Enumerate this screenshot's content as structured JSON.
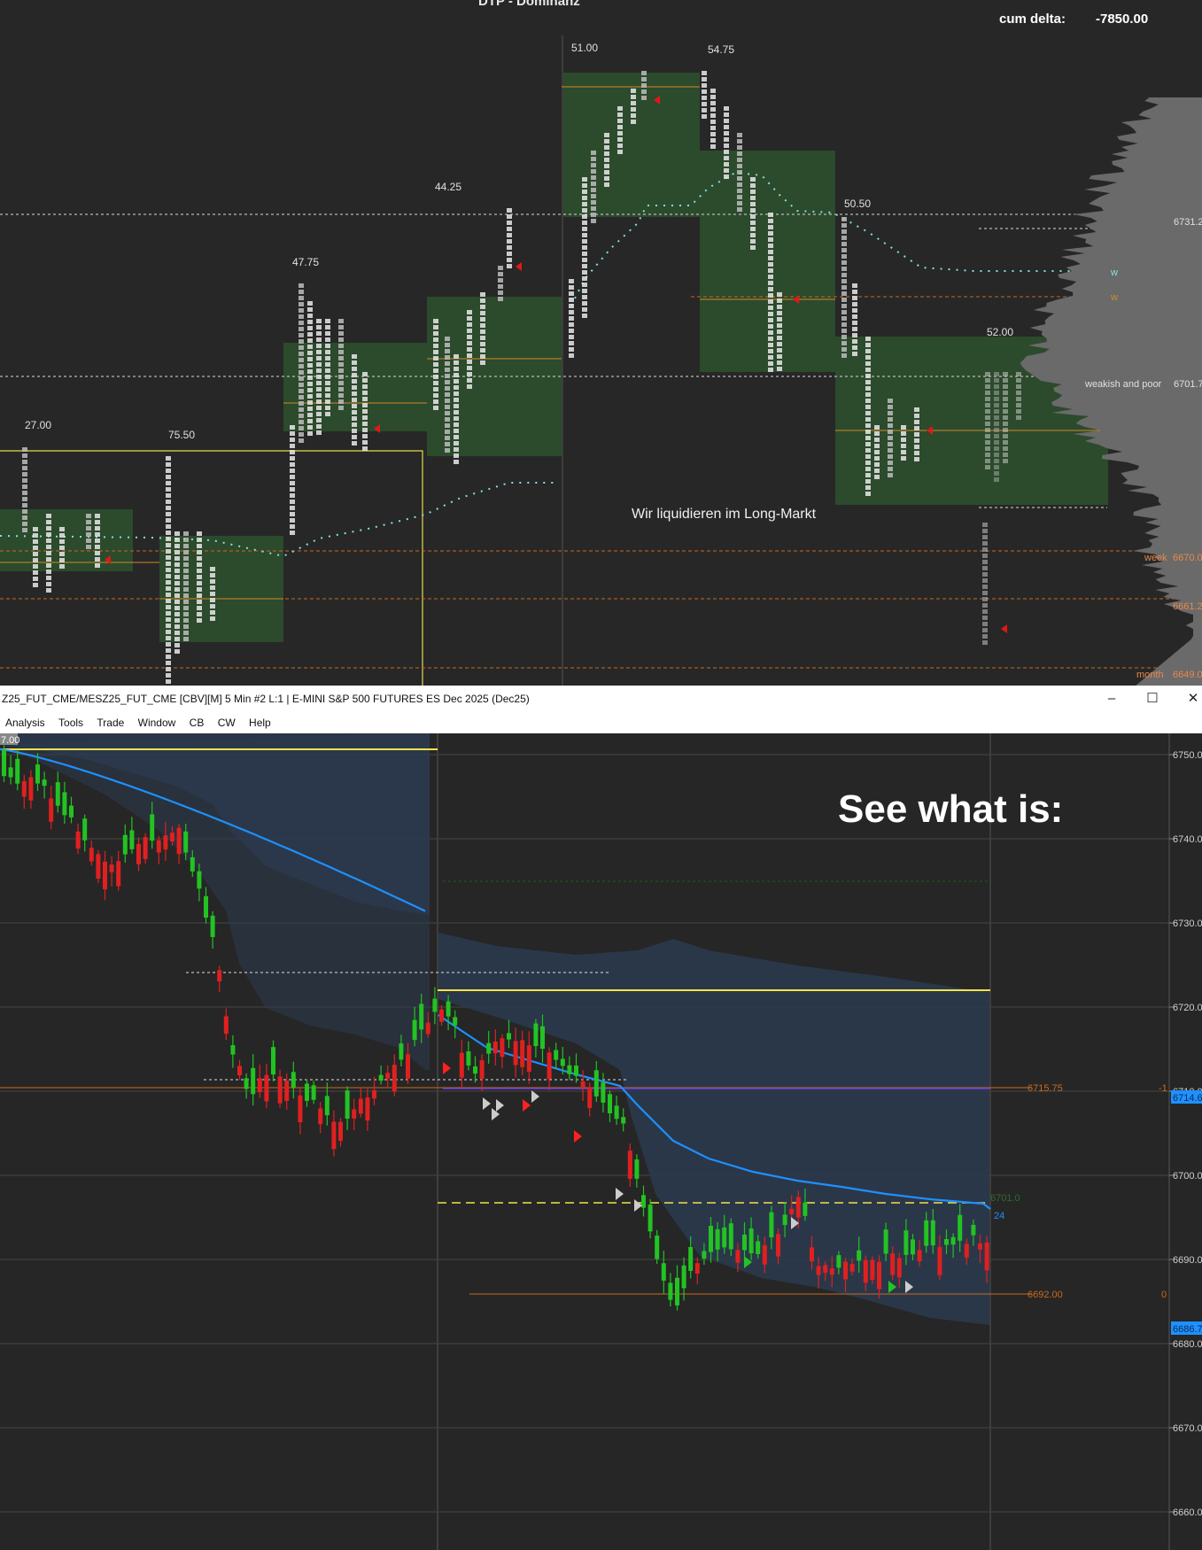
{
  "top_chart": {
    "title": "DTP - Dominanz",
    "cum_delta_label": "cum delta:",
    "cum_delta_value": "-7850.00",
    "profile_labels": [
      "27.00",
      "75.50",
      "47.75",
      "44.25",
      "51.00",
      "54.75",
      "50.50",
      "52.00"
    ],
    "annotation": "Wir liquidieren im Long-Markt",
    "marker_w": "w",
    "right_labels": {
      "p6731": "6731.2",
      "weakish_text": "weakish and poor",
      "p6701": "6701.7",
      "week_text": "week",
      "p6670": "6670.0",
      "p6661": "6661.2",
      "month_text": "month",
      "p6649": "6649.0"
    }
  },
  "window": {
    "title": "Z25_FUT_CME/MESZ25_FUT_CME [CBV][M]  5 Min  #2 L:1 | E-MINI S&P 500 FUTURES ES Dec 2025 (Dec25)",
    "controls": {
      "minimize": "–",
      "maximize": "☐",
      "close": "✕"
    }
  },
  "menu": [
    "Analysis",
    "Tools",
    "Trade",
    "Window",
    "CB",
    "CW",
    "Help"
  ],
  "bottom_chart": {
    "corner_label": "7.00",
    "headline": "See what is:",
    "level_6715": "6715.75",
    "level_6692": "6692.00",
    "right_minus1": "-1",
    "right_zero": "0",
    "blue_tag_top": "6714.6",
    "blue_tag_bottom": "6686.7",
    "vwap_count": "24",
    "green_tag": "6701.0",
    "price_axis": [
      "6750.0",
      "6740.0",
      "6730.0",
      "6720.0",
      "6710.0",
      "6700.0",
      "6690.0",
      "6680.0",
      "6670.0",
      "6660.0"
    ]
  },
  "colors": {
    "background": "#262626",
    "value_area": "#2c4a2c",
    "cloud": "#2b3a4e",
    "vwap": "#1e90ff",
    "up_candle": "#22c322",
    "down_candle": "#e02020",
    "level_orange": "#c86a1e",
    "yellow": "#f2e34a",
    "purple": "#6a3fd8"
  }
}
